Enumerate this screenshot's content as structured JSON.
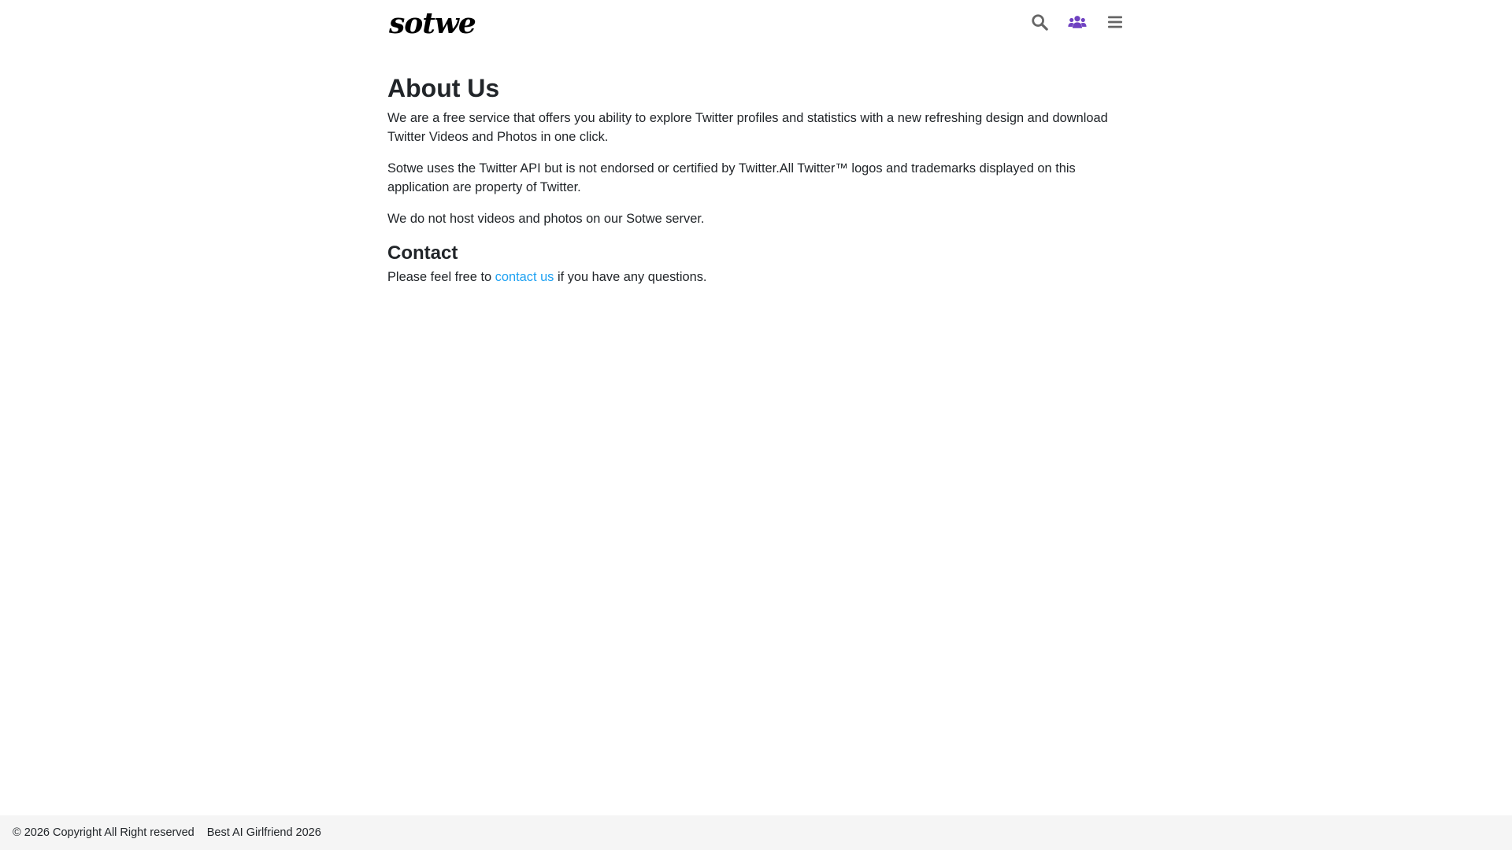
{
  "header": {
    "logo_text": "sotwe",
    "icons": {
      "search": "search-icon",
      "users": "users-icon",
      "menu": "menu-icon"
    },
    "colors": {
      "search_icon": "#666666",
      "users_icon": "#6f42c1",
      "menu_icon": "#666666"
    }
  },
  "about": {
    "title": "About Us",
    "paragraph_1": "We are a free service that offers you ability to explore Twitter profiles and statistics with a new refreshing design and download Twitter Videos and Photos in one click.",
    "paragraph_2": "Sotwe uses the Twitter API but is not endorsed or certified by Twitter.All Twitter™ logos and trademarks displayed on this application are property of Twitter.",
    "paragraph_3": "We do not host videos and photos on our Sotwe server."
  },
  "contact": {
    "title": "Contact",
    "text_before": "Please feel free to ",
    "link_text": "contact us",
    "text_after": " if you have any questions."
  },
  "footer": {
    "copyright": "© 2026 Copyright All Right reserved",
    "link": "Best AI Girlfriend 2026"
  },
  "colors": {
    "link": "#1da1f2",
    "footer_bg": "#f5f5f5",
    "text": "#212529"
  }
}
